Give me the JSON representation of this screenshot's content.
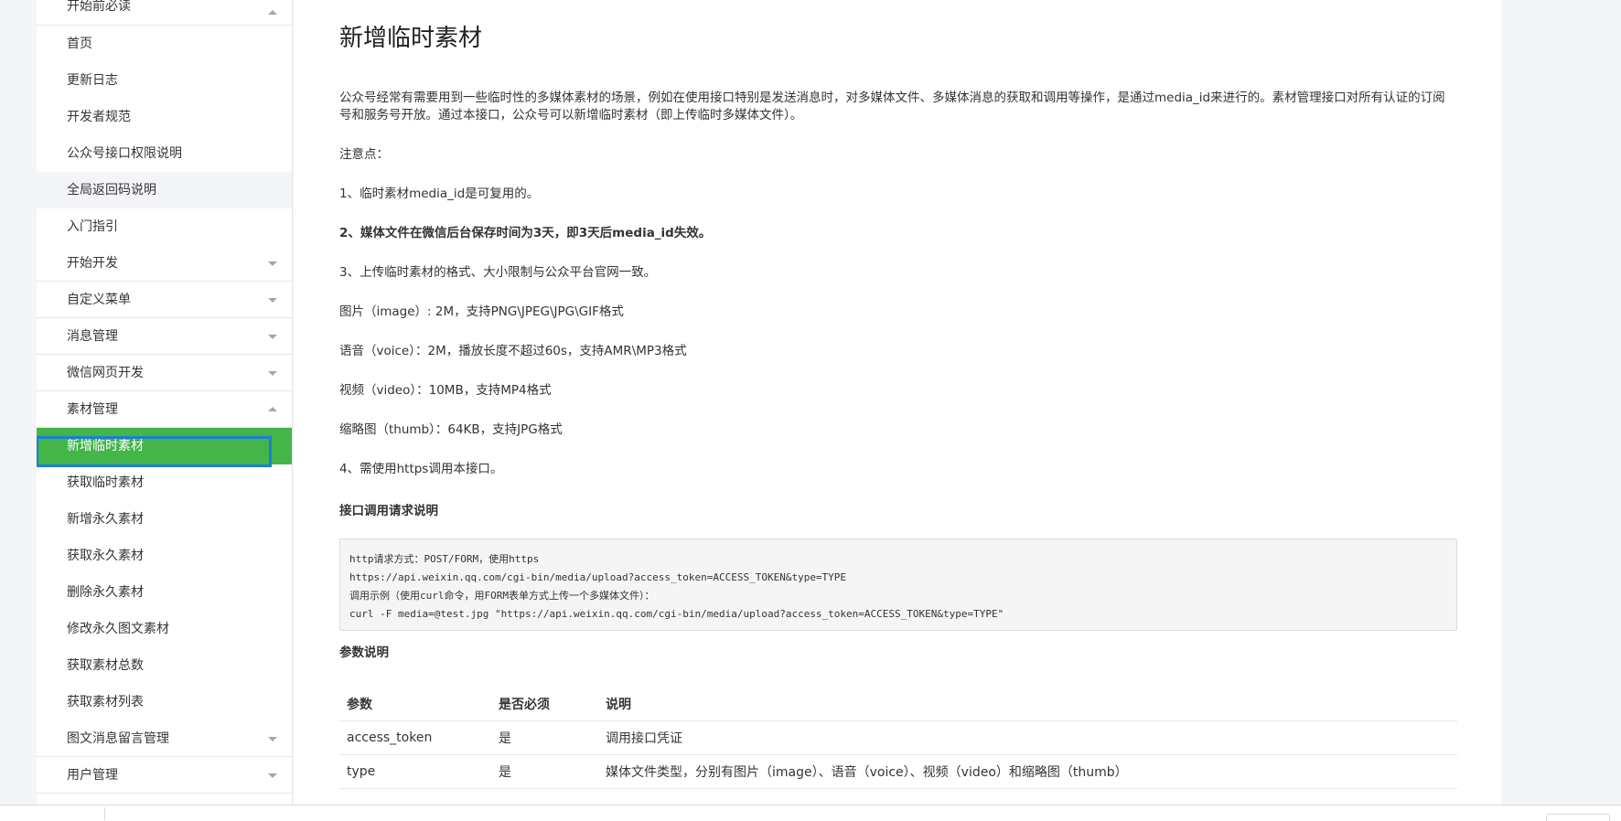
{
  "sidebar": {
    "items": [
      {
        "label": "开始前必读",
        "arrow": "up",
        "kind": "group",
        "first": true
      },
      {
        "label": "首页",
        "kind": "child"
      },
      {
        "label": "更新日志",
        "kind": "child"
      },
      {
        "label": "开发者规范",
        "kind": "child"
      },
      {
        "label": "公众号接口权限说明",
        "kind": "child"
      },
      {
        "label": "全局返回码说明",
        "kind": "child",
        "highlight": true
      },
      {
        "label": "入门指引",
        "kind": "child"
      },
      {
        "label": "开始开发",
        "arrow": "down",
        "kind": "group"
      },
      {
        "label": "自定义菜单",
        "arrow": "down",
        "kind": "group"
      },
      {
        "label": "消息管理",
        "arrow": "down",
        "kind": "group"
      },
      {
        "label": "微信网页开发",
        "arrow": "down",
        "kind": "group"
      },
      {
        "label": "素材管理",
        "arrow": "up",
        "kind": "group"
      },
      {
        "label": "新增临时素材",
        "kind": "child",
        "active": true
      },
      {
        "label": "获取临时素材",
        "kind": "child"
      },
      {
        "label": "新增永久素材",
        "kind": "child"
      },
      {
        "label": "获取永久素材",
        "kind": "child"
      },
      {
        "label": "删除永久素材",
        "kind": "child"
      },
      {
        "label": "修改永久图文素材",
        "kind": "child"
      },
      {
        "label": "获取素材总数",
        "kind": "child"
      },
      {
        "label": "获取素材列表",
        "kind": "child"
      },
      {
        "label": "图文消息留言管理",
        "arrow": "down",
        "kind": "group"
      },
      {
        "label": "用户管理",
        "arrow": "down",
        "kind": "group"
      }
    ]
  },
  "content": {
    "title": "新增临时素材",
    "intro": "公众号经常有需要用到一些临时性的多媒体素材的场景，例如在使用接口特别是发送消息时，对多媒体文件、多媒体消息的获取和调用等操作，是通过media_id来进行的。素材管理接口对所有认证的订阅号和服务号开放。通过本接口，公众号可以新增临时素材（即上传临时多媒体文件）。",
    "notice_title": "注意点：",
    "note1": "1、临时素材media_id是可复用的。",
    "note2": "2、媒体文件在微信后台保存时间为3天，即3天后media_id失效。",
    "note3": "3、上传临时素材的格式、大小限制与公众平台官网一致。",
    "fmt_image": "图片（image）: 2M，支持PNG\\JPEG\\JPG\\GIF格式",
    "fmt_voice": "语音（voice）：2M，播放长度不超过60s，支持AMR\\MP3格式",
    "fmt_video": "视频（video）：10MB，支持MP4格式",
    "fmt_thumb": "缩略图（thumb）：64KB，支持JPG格式",
    "note4": "4、需使用https调用本接口。",
    "request_title": "接口调用请求说明",
    "code_lines": [
      "http请求方式：POST/FORM，使用https",
      "https://api.weixin.qq.com/cgi-bin/media/upload?access_token=ACCESS_TOKEN&type=TYPE",
      "调用示例（使用curl命令，用FORM表单方式上传一个多媒体文件）：",
      "curl -F media=@test.jpg \"https://api.weixin.qq.com/cgi-bin/media/upload?access_token=ACCESS_TOKEN&type=TYPE\""
    ],
    "params_title": "参数说明",
    "table": {
      "headers": [
        "参数",
        "是否必须",
        "说明"
      ],
      "rows": [
        [
          "access_token",
          "是",
          "调用接口凭证"
        ],
        [
          "type",
          "是",
          "媒体文件类型，分别有图片（image）、语音（voice）、视频（video）和缩略图（thumb）"
        ]
      ]
    }
  },
  "colors": {
    "active_bg": "#44b549",
    "focus_ring": "#1a7fd6"
  }
}
